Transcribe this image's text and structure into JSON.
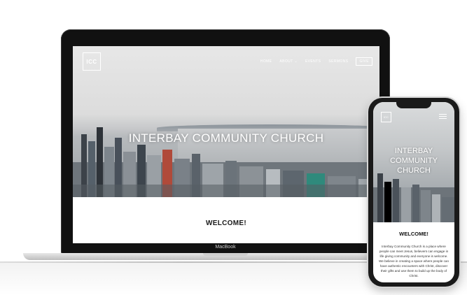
{
  "laptop": {
    "logo": "ICC",
    "nav": {
      "home": "HOME",
      "about": "ABOUT ⌄",
      "events": "EVENTS",
      "sermons": "SERMONS",
      "give": "GIVE"
    },
    "hero_title": "INTERBAY COMMUNITY CHURCH",
    "welcome_heading": "WELCOME!",
    "brand_label": "MacBook"
  },
  "phone": {
    "logo": "ICC",
    "menu_icon": "hamburger-menu-icon",
    "hero_title": "INTERBAY COMMUNITY CHURCH",
    "welcome_heading": "WELCOME!",
    "welcome_text": "Interbay Community Church is a place where people can meet Jesus, believers can engage in life giving community and everyone is welcome. We believe in creating a space where people can have authentic encounters with Christ, discover their gifts and use them to build up the body of Christ."
  },
  "colors": {
    "device_frame": "#111111",
    "hero_text": "#ffffff",
    "heading_text": "#1a1a1a"
  }
}
